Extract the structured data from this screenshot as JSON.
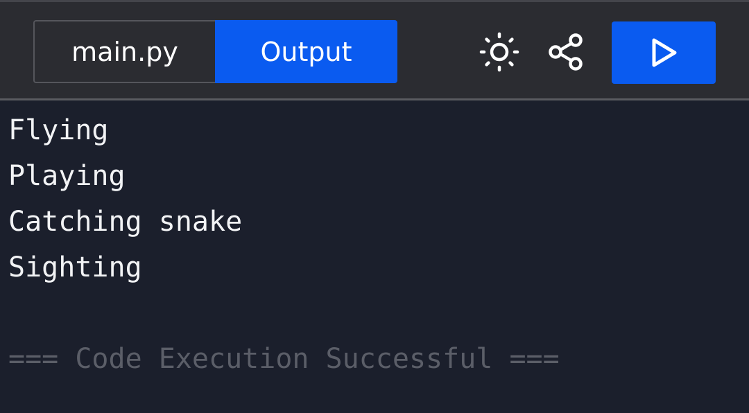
{
  "tabs": {
    "file_label": "main.py",
    "output_label": "Output"
  },
  "icons": {
    "theme": "sun-icon",
    "share": "share-icon",
    "run": "play-icon"
  },
  "colors": {
    "accent": "#0a5bf0",
    "toolbar_bg": "#2b2c31",
    "output_bg": "#1b1f2c",
    "output_text": "#f2f3f5",
    "status_text": "#5b5e68"
  },
  "output": {
    "lines": [
      "Flying",
      "Playing",
      "Catching snake",
      "Sighting"
    ],
    "status": "=== Code Execution Successful ==="
  }
}
